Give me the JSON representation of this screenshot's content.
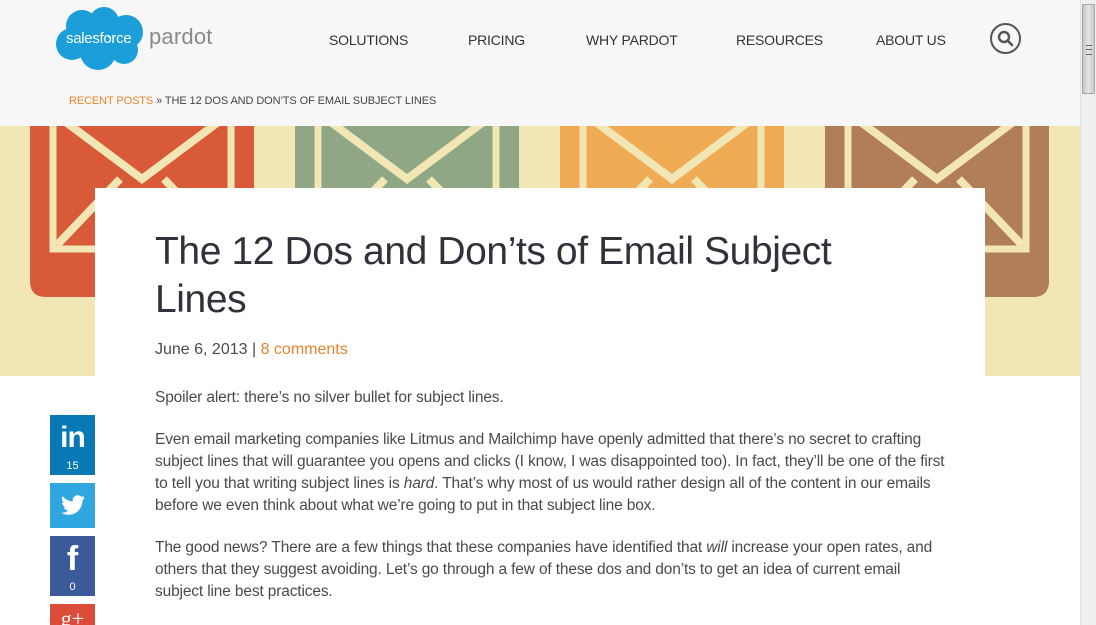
{
  "header": {
    "logo": {
      "badge_text": "salesforce",
      "product_text": "pardot",
      "badge_color": "#1b9ed9"
    },
    "nav": [
      {
        "label": "SOLUTIONS"
      },
      {
        "label": "PRICING"
      },
      {
        "label": "WHY PARDOT"
      },
      {
        "label": "RESOURCES"
      },
      {
        "label": "ABOUT US"
      }
    ],
    "search_icon": "search-icon"
  },
  "breadcrumb": {
    "link_label": "RECENT POSTS",
    "separator": " » ",
    "current": "THE 12 DOS AND DON’TS OF EMAIL SUBJECT LINES"
  },
  "hero": {
    "envelope_colors": [
      "#d85a38",
      "#8fa784",
      "#f0ac55",
      "#b27e57"
    ],
    "background_color": "#f2e6b5"
  },
  "article": {
    "title": "The 12 Dos and Don’ts of Email Subject Lines",
    "date": "June 6, 2013",
    "meta_separator": " | ",
    "comments_label": "8 comments",
    "paragraphs": [
      {
        "text": "Spoiler alert: there’s no silver bullet for subject lines."
      },
      {
        "before": "Even email marketing companies like Litmus and Mailchimp have openly admitted that there’s no secret to crafting subject lines that will guarantee you opens and clicks (I know, I was disappointed too). In fact, they’ll be one of the first to tell you that writing subject lines is ",
        "em": "hard",
        "after": ". That’s why most of us would rather design all of the content in our emails before we even think about what we’re going to put in that subject line box."
      },
      {
        "before": "The good news? There are a few things that these companies have identified that ",
        "em": "will",
        "after": " increase your open rates, and others that they suggest avoiding. Let’s go through a few of these dos and don’ts to get an idea of current email subject line best practices."
      }
    ]
  },
  "share": {
    "linkedin": {
      "glyph": "in",
      "count": "15",
      "color": "#0879b4"
    },
    "twitter": {
      "color": "#2fa6e0"
    },
    "facebook": {
      "glyph": "f",
      "count": "0",
      "color": "#3b5a9a"
    },
    "googleplus": {
      "glyph": "g+",
      "color": "#dd4b39"
    }
  },
  "accent_color": "#e8842c"
}
